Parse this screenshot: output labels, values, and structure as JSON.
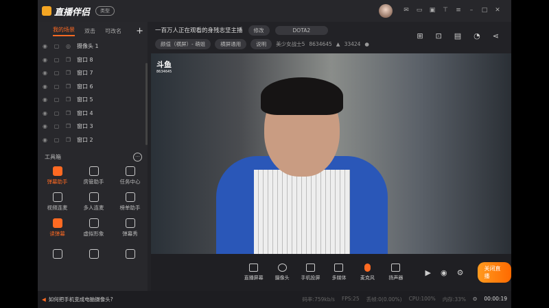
{
  "app": {
    "name": "直播伴侣",
    "type_button": "类型"
  },
  "left": {
    "tabs": [
      "我的场景",
      "双击",
      "可改名"
    ],
    "scenes": [
      "摄像头 1",
      "窗口 8",
      "窗口 7",
      "窗口 6",
      "窗口 5",
      "窗口 4",
      "窗口 3",
      "窗口 2"
    ],
    "toolbox_title": "工具箱",
    "tools": [
      "弹幕助手",
      "房管助手",
      "任务中心",
      "视频连麦",
      "多人连麦",
      "榜单助手",
      "读弹幕",
      "虚拟形象",
      "弹幕秀",
      "",
      "",
      ""
    ]
  },
  "header": {
    "title": "一百万人正在观看的身残志坚主播",
    "edit": "修改",
    "game": "DOTA2",
    "category": "颜值（横屏）- 萌姐",
    "mode": "横屏通用",
    "explain": "说明",
    "user": "美少女战士5",
    "room_id": "8634645",
    "heat": "33424"
  },
  "video": {
    "watermark": "斗鱼",
    "watermark_sub": "8634645"
  },
  "toolbar": {
    "items": [
      "直播屏幕",
      "摄像头",
      "手机投屏",
      "多媒体",
      "麦克风",
      "扬声器"
    ],
    "live_button": "关闭直播"
  },
  "status": {
    "tip": "如何把手机变成电脑摄像头?",
    "bitrate": "码率:759kb/s",
    "fps": "FPS:25",
    "drop": "丢帧:0(0.00%)",
    "cpu": "CPU:100%",
    "mem": "内存:33%",
    "timer": "00:00:19"
  }
}
